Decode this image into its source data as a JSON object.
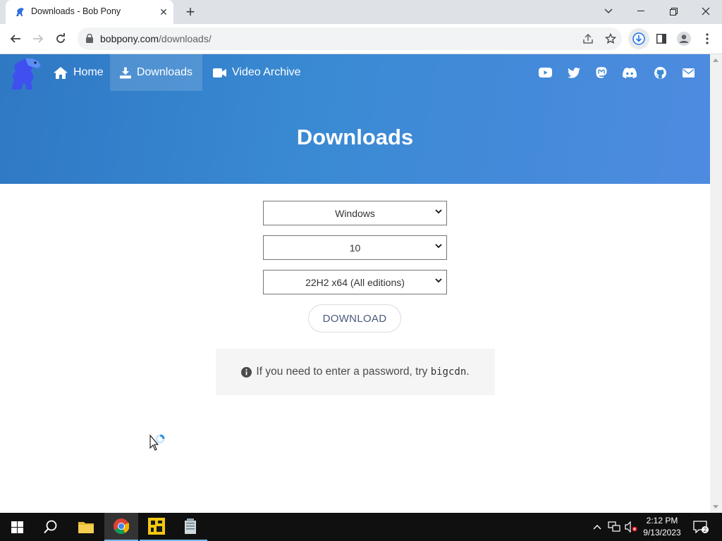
{
  "browser": {
    "tab_title": "Downloads - Bob Pony",
    "url_host": "bobpony.com",
    "url_path": "/downloads/"
  },
  "nav": {
    "items": [
      {
        "label": "Home",
        "icon": "home-icon"
      },
      {
        "label": "Downloads",
        "icon": "download-icon",
        "active": true
      },
      {
        "label": "Video Archive",
        "icon": "video-camera-icon"
      }
    ],
    "social_icons": [
      "youtube-icon",
      "twitter-icon",
      "mastodon-icon",
      "discord-icon",
      "github-icon",
      "email-icon"
    ]
  },
  "hero": {
    "title": "Downloads"
  },
  "form": {
    "os_select": "Windows",
    "version_select": "10",
    "edition_select": "22H2 x64 (All editions)",
    "download_label": "DOWNLOAD"
  },
  "notice": {
    "text": "If you need to enter a password, try ",
    "code": "bigcdn",
    "suffix": "."
  },
  "taskbar": {
    "time": "2:12 PM",
    "date": "9/13/2023",
    "notification_count": "2"
  },
  "colors": {
    "hero_start": "#2f78c4",
    "hero_end": "#4e8be0",
    "taskbar": "#101010"
  }
}
